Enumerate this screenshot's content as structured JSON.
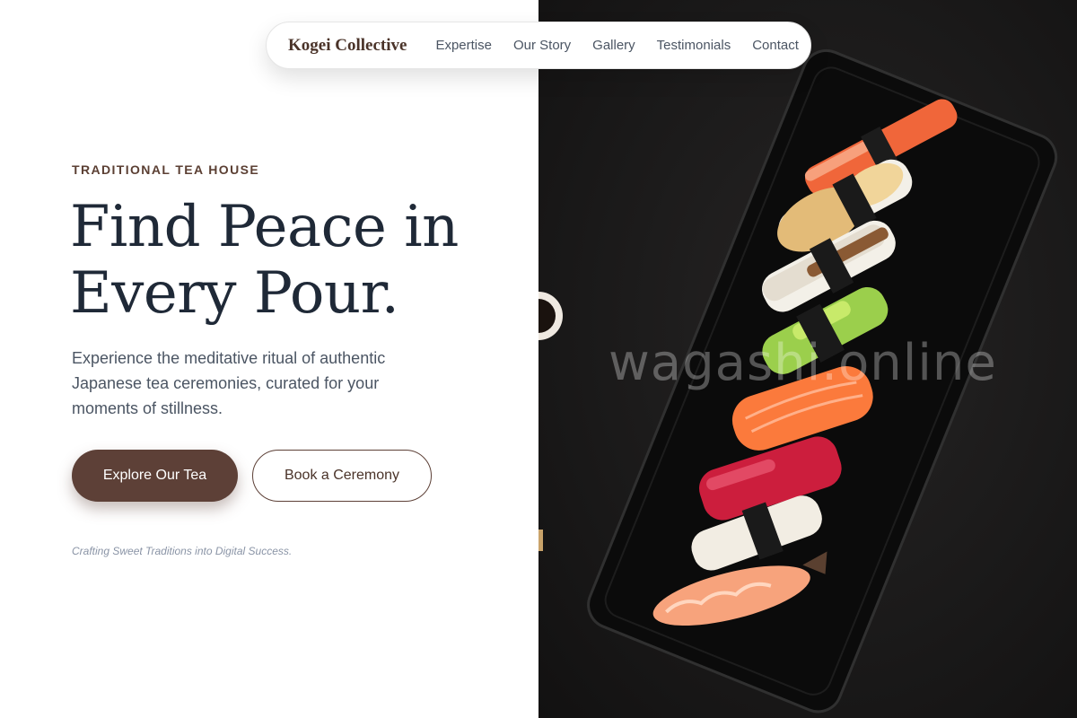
{
  "nav": {
    "brand": "Kogei Collective",
    "links": [
      "Expertise",
      "Our Story",
      "Gallery",
      "Testimonials",
      "Contact"
    ]
  },
  "hero": {
    "eyebrow": "TRADITIONAL TEA HOUSE",
    "headline_line1": "Find Peace in",
    "headline_line2": "Every Pour.",
    "subcopy": "Experience the meditative ritual of authentic Japanese tea ceremonies, curated for your moments of stillness.",
    "primary_cta": "Explore Our Tea",
    "secondary_cta": "Book a Ceremony",
    "tagline": "Crafting Sweet Traditions into Digital Success."
  },
  "photo": {
    "watermark": "wagashi.online",
    "subject_icon": "sushi-platter-photo"
  },
  "colors": {
    "brand_brown": "#5d4037",
    "heading_navy": "#1f2937",
    "body_gray": "#4b5563",
    "photo_background": "#1b1a1a"
  }
}
